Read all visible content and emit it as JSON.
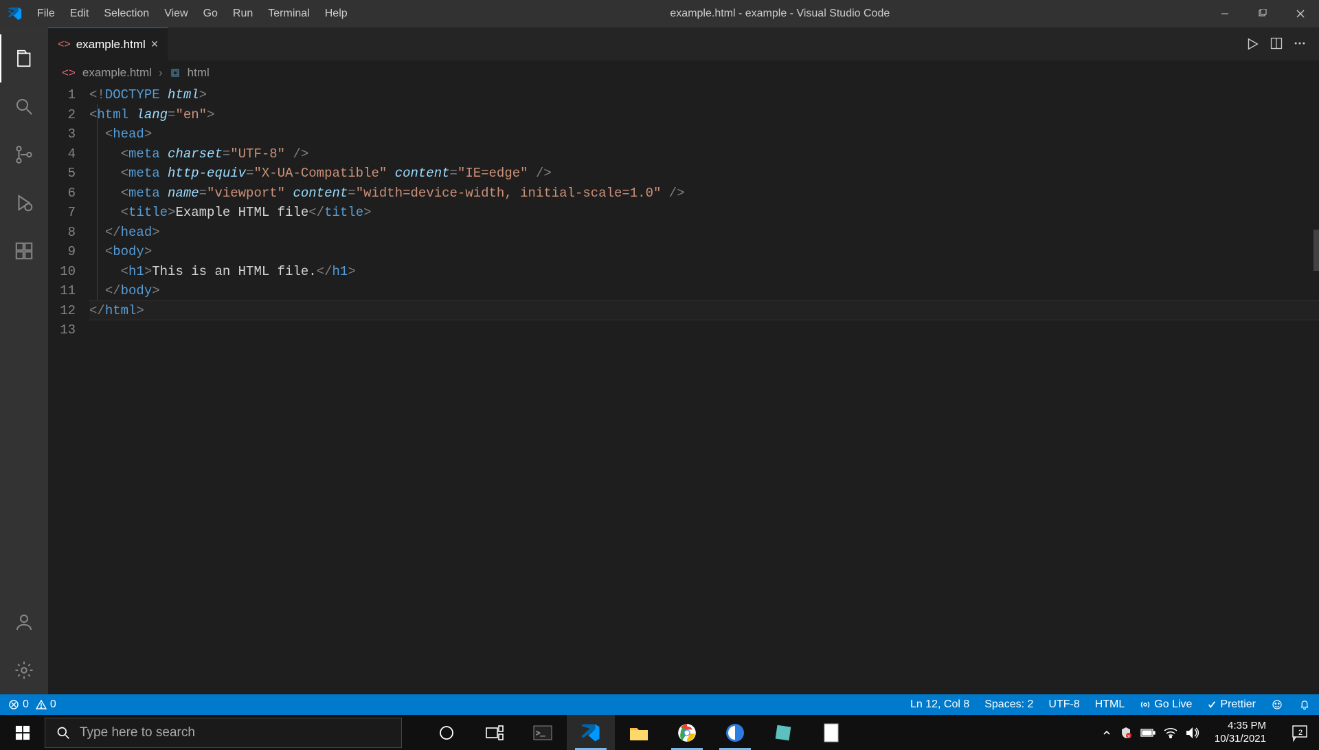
{
  "titlebar": {
    "menus": [
      "File",
      "Edit",
      "Selection",
      "View",
      "Go",
      "Run",
      "Terminal",
      "Help"
    ],
    "title": "example.html - example - Visual Studio Code"
  },
  "tab": {
    "name": "example.html"
  },
  "breadcrumb": {
    "file": "example.html",
    "symbol": "html"
  },
  "code": {
    "numbers": [
      "1",
      "2",
      "3",
      "4",
      "5",
      "6",
      "7",
      "8",
      "9",
      "10",
      "11",
      "12",
      "13"
    ],
    "l1": {
      "a": "<!",
      "b": "DOCTYPE",
      "c": " html",
      "d": ">"
    },
    "l2": {
      "a": "<",
      "b": "html",
      "c": " lang",
      "d": "=",
      "e": "\"en\"",
      "f": ">"
    },
    "l3_indent": "  ",
    "l3": {
      "a": "<",
      "b": "head",
      "c": ">"
    },
    "l4_indent": "    ",
    "l4": {
      "a": "<",
      "b": "meta",
      "c": " charset",
      "d": "=",
      "e": "\"UTF-8\"",
      "f": " />"
    },
    "l5_indent": "    ",
    "l5": {
      "a": "<",
      "b": "meta",
      "c": " http-equiv",
      "d": "=",
      "e": "\"X-UA-Compatible\"",
      "f": " content",
      "g": "=",
      "h": "\"IE=edge\"",
      "i": " />"
    },
    "l6_indent": "    ",
    "l6": {
      "a": "<",
      "b": "meta",
      "c": " name",
      "d": "=",
      "e": "\"viewport\"",
      "f": " content",
      "g": "=",
      "h": "\"width=device-width, initial-scale=1.0\"",
      "i": " />"
    },
    "l7_indent": "    ",
    "l7": {
      "a": "<",
      "b": "title",
      "c": ">",
      "d": "Example HTML file",
      "e": "</",
      "f": "title",
      "g": ">"
    },
    "l8_indent": "  ",
    "l8": {
      "a": "</",
      "b": "head",
      "c": ">"
    },
    "l9_indent": "  ",
    "l9": {
      "a": "<",
      "b": "body",
      "c": ">"
    },
    "l10_indent": "    ",
    "l10": {
      "a": "<",
      "b": "h1",
      "c": ">",
      "d": "This is an HTML file.",
      "e": "</",
      "f": "h1",
      "g": ">"
    },
    "l11_indent": "  ",
    "l11": {
      "a": "</",
      "b": "body",
      "c": ">"
    },
    "l12": {
      "a": "</",
      "b": "html",
      "c": ">"
    }
  },
  "status": {
    "errors": "0",
    "warnings": "0",
    "position": "Ln 12, Col 8",
    "spaces": "Spaces: 2",
    "encoding": "UTF-8",
    "language": "HTML",
    "golive": "Go Live",
    "prettier": "Prettier"
  },
  "taskbar": {
    "search_placeholder": "Type here to search",
    "time": "4:35 PM",
    "date": "10/31/2021",
    "notif_count": "2"
  }
}
